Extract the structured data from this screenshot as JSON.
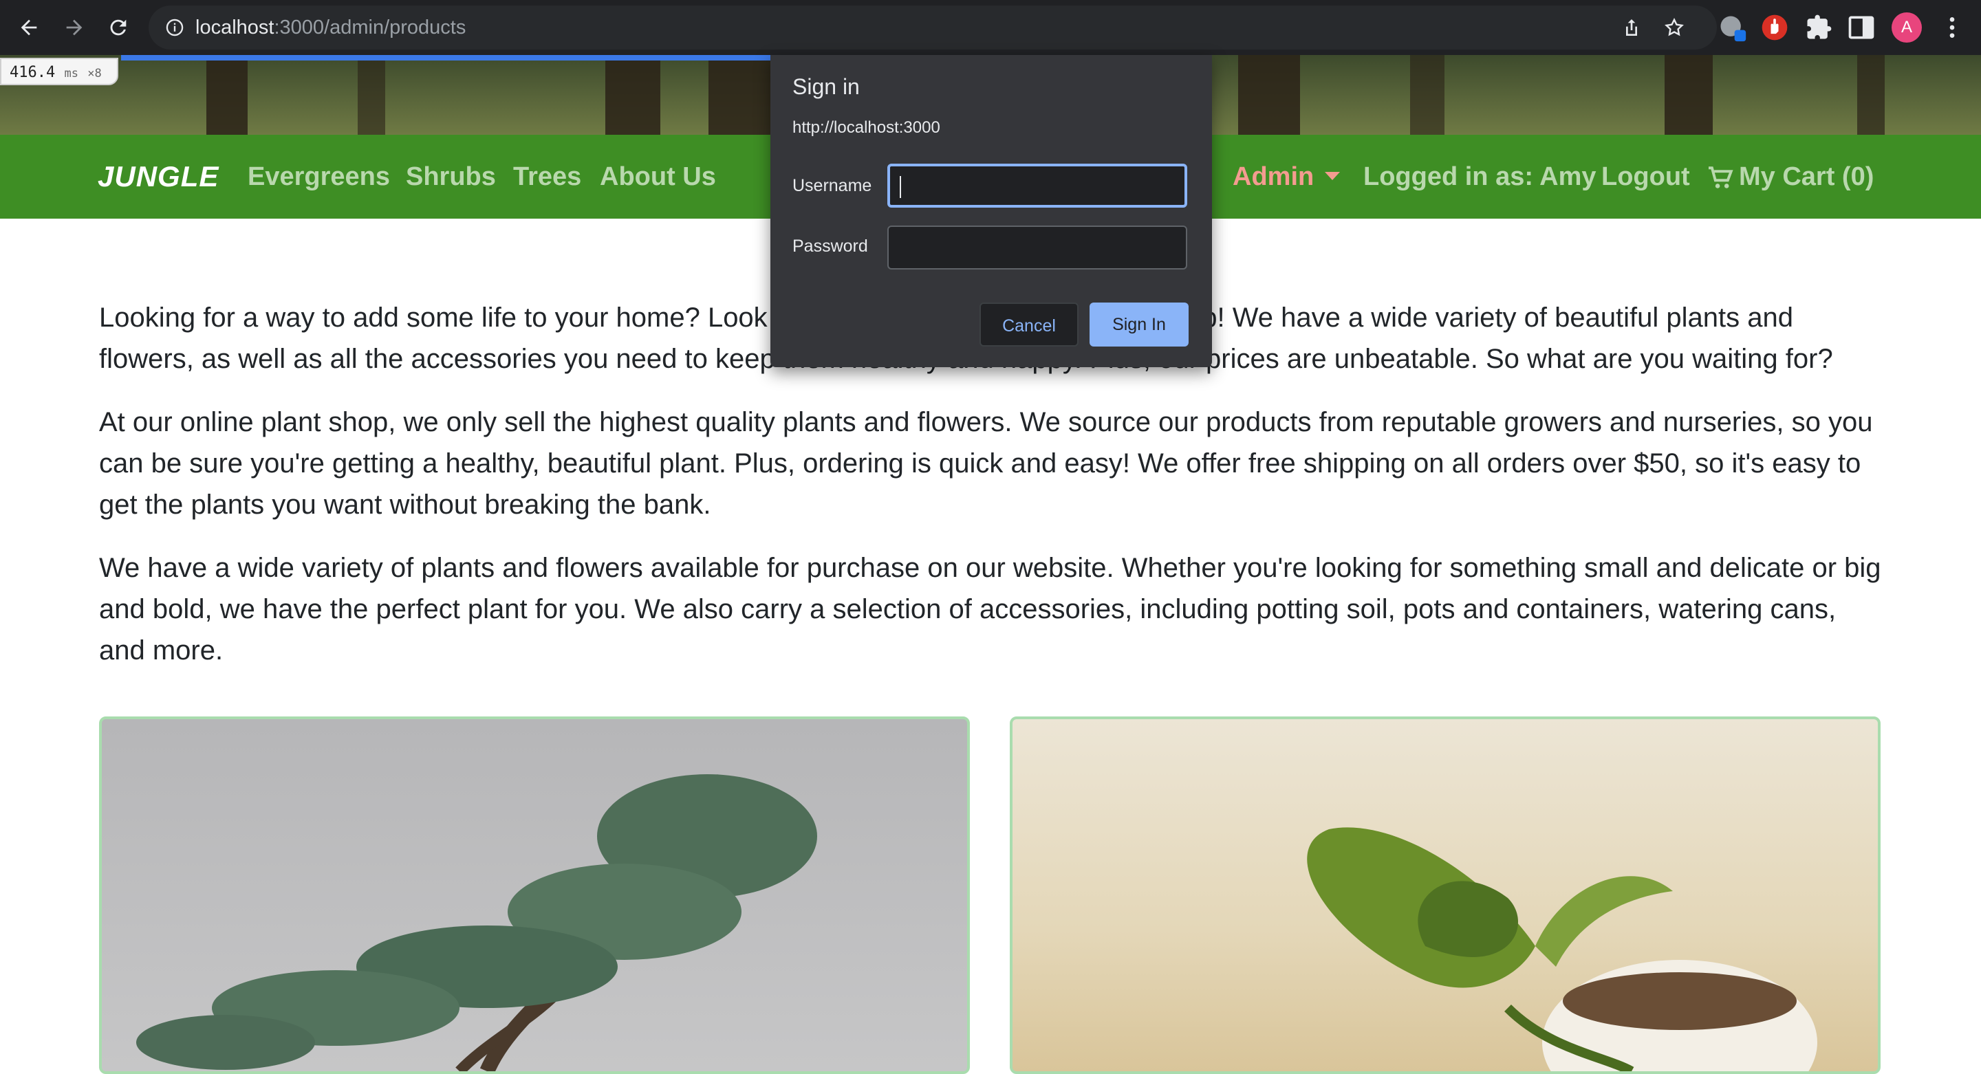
{
  "browser": {
    "url_host": "localhost",
    "url_path": ":3000/admin/products",
    "profile_initial": "A",
    "icons": [
      "back-icon",
      "forward-icon",
      "reload-icon",
      "site-info-icon",
      "share-icon",
      "star-icon",
      "extension-icon",
      "puzzle-icon",
      "sidepanel-icon",
      "menu-icon"
    ]
  },
  "perf": {
    "time": "416.4",
    "unit": "ms",
    "count": "×8"
  },
  "navbar": {
    "brand": "JUNGLE",
    "links": [
      "Evergreens",
      "Shrubs",
      "Trees",
      "About Us"
    ],
    "admin": "Admin",
    "logged_in": "Logged in as: Amy",
    "logout": "Logout",
    "cart": "My Cart (0)"
  },
  "content": {
    "p1": "Looking for a way to add some life to your home? Look no further than our online plant shop! We have a wide variety of beautiful plants and flowers, as well as all the accessories you need to keep them healthy and happy. Plus, our prices are unbeatable. So what are you waiting for?",
    "p2": "At our online plant shop, we only sell the highest quality plants and flowers. We source our products from reputable growers and nurseries, so you can be sure you're getting a healthy, beautiful plant. Plus, ordering is quick and easy! We offer free shipping on all orders over $50, so it's easy to get the plants you want without breaking the bank.",
    "p3": "We have a wide variety of plants and flowers available for purchase on our website. Whether you're looking for something small and delicate or big and bold, we have the perfect plant for you. We also carry a selection of accessories, including potting soil, pots and containers, watering cans, and more."
  },
  "dialog": {
    "title": "Sign in",
    "origin": "http://localhost:3000",
    "username_label": "Username",
    "username_value": "",
    "password_label": "Password",
    "password_value": "",
    "cancel": "Cancel",
    "sign_in": "Sign In"
  },
  "colors": {
    "navbar": "#3e8e24",
    "nav_link": "#b9d8ad",
    "admin_link": "#f49c90",
    "dialog_bg": "#35363a",
    "accent": "#8ab4f8"
  }
}
